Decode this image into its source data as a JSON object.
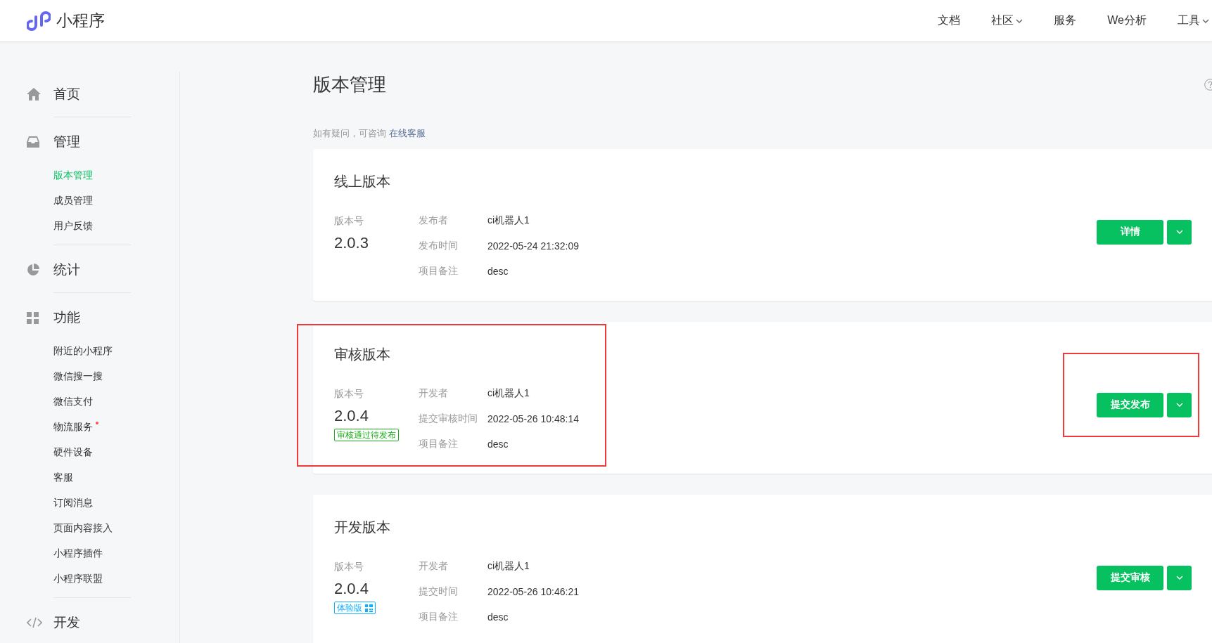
{
  "app": {
    "name": "小程序"
  },
  "top_nav": [
    {
      "label": "文档",
      "dropdown": false
    },
    {
      "label": "社区",
      "dropdown": true
    },
    {
      "label": "服务",
      "dropdown": false
    },
    {
      "label": "We分析",
      "dropdown": false
    },
    {
      "label": "工具",
      "dropdown": true
    }
  ],
  "sidebar": [
    {
      "label": "首页"
    },
    {
      "label": "管理",
      "items": [
        {
          "label": "版本管理",
          "selected": true,
          "dot": false
        },
        {
          "label": "成员管理",
          "selected": false,
          "dot": false
        },
        {
          "label": "用户反馈",
          "selected": false,
          "dot": false
        }
      ]
    },
    {
      "label": "统计"
    },
    {
      "label": "功能",
      "items": [
        {
          "label": "附近的小程序",
          "selected": false,
          "dot": false
        },
        {
          "label": "微信搜一搜",
          "selected": false,
          "dot": false
        },
        {
          "label": "微信支付",
          "selected": false,
          "dot": false
        },
        {
          "label": "物流服务",
          "selected": false,
          "dot": true
        },
        {
          "label": "硬件设备",
          "selected": false,
          "dot": false
        },
        {
          "label": "客服",
          "selected": false,
          "dot": false
        },
        {
          "label": "订阅消息",
          "selected": false,
          "dot": false
        },
        {
          "label": "页面内容接入",
          "selected": false,
          "dot": false
        },
        {
          "label": "小程序插件",
          "selected": false,
          "dot": false
        },
        {
          "label": "小程序联盟",
          "selected": false,
          "dot": false
        }
      ]
    },
    {
      "label": "开发"
    }
  ],
  "page": {
    "title": "版本管理",
    "hint": "如有疑问，可咨询",
    "hint_link": "在线客服"
  },
  "cards": [
    {
      "title": "线上版本",
      "version_label": "版本号",
      "version": "2.0.3",
      "fields": [
        {
          "label": "发布者",
          "value": "ci机器人1"
        },
        {
          "label": "发布时间",
          "value": "2022-05-24 21:32:09"
        },
        {
          "label": "项目备注",
          "value": "desc"
        }
      ],
      "button": "详情",
      "annotated": false
    },
    {
      "title": "审核版本",
      "version_label": "版本号",
      "version": "2.0.4",
      "tag": {
        "kind": "approved",
        "text": "审核通过待发布"
      },
      "fields": [
        {
          "label": "开发者",
          "value": "ci机器人1"
        },
        {
          "label": "提交审核时间",
          "value": "2022-05-26 10:48:14"
        },
        {
          "label": "项目备注",
          "value": "desc"
        }
      ],
      "button": "提交发布",
      "annotated": true
    },
    {
      "title": "开发版本",
      "version_label": "版本号",
      "version": "2.0.4",
      "tag": {
        "kind": "trial",
        "text": "体验版"
      },
      "fields": [
        {
          "label": "开发者",
          "value": "ci机器人1"
        },
        {
          "label": "提交时间",
          "value": "2022-05-26 10:46:21"
        },
        {
          "label": "项目备注",
          "value": "desc"
        }
      ],
      "button": "提交审核",
      "annotated": false
    }
  ]
}
